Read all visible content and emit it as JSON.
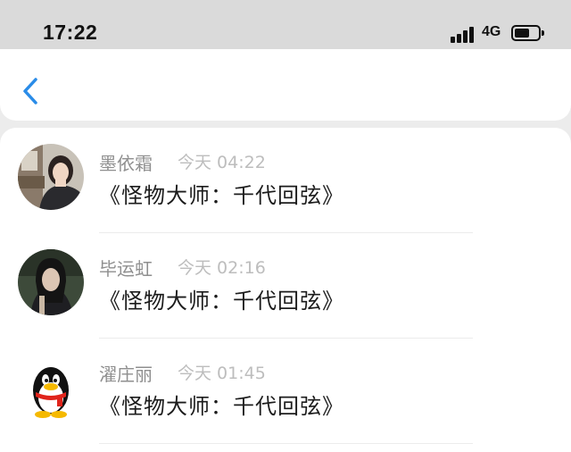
{
  "status_bar": {
    "time": "17:22",
    "network": "4G",
    "signal_bars": 4,
    "battery_level": 0.65
  },
  "nav_bar": {
    "back_icon": "chevron-left-icon",
    "accent_color": "#2a8ce8"
  },
  "list": [
    {
      "name": "墨依霜",
      "time": "今天 04:22",
      "message": "《怪物大师：千代回弦》",
      "avatar": "photo-girl-avatar"
    },
    {
      "name": "毕运虹",
      "time": "今天 02:16",
      "message": "《怪物大师：千代回弦》",
      "avatar": "photo-costume-avatar"
    },
    {
      "name": "濯庄丽",
      "time": "今天 01:45",
      "message": "《怪物大师：千代回弦》",
      "avatar": "qq-penguin-avatar"
    }
  ]
}
